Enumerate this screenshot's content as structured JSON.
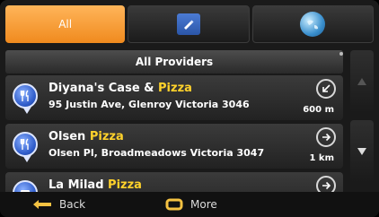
{
  "tabs": {
    "all_label": "All",
    "edit_icon": "edit-icon",
    "globe_icon": "globe-icon"
  },
  "provider_header": "All Providers",
  "results": [
    {
      "name_prefix": "Diyana's Case & ",
      "name_highlight": "Pizza",
      "name_suffix": "",
      "address": "95 Justin Ave, Glenroy Victoria 3046",
      "distance": "600 m",
      "direction_icon": "arrow-down-left-icon",
      "category_icon": "restaurant-icon"
    },
    {
      "name_prefix": "Olsen ",
      "name_highlight": "Pizza",
      "name_suffix": "",
      "address": "Olsen Pl, Broadmeadows Victoria 3047",
      "distance": "1 km",
      "direction_icon": "arrow-right-icon",
      "category_icon": "restaurant-icon"
    },
    {
      "name_prefix": "La Milad ",
      "name_highlight": "Pizza",
      "name_suffix": "",
      "address": "",
      "distance": "",
      "direction_icon": "arrow-right-icon",
      "category_icon": "car-icon"
    }
  ],
  "bottom": {
    "back_label": "Back",
    "more_label": "More"
  },
  "colors": {
    "accent_orange": "#f5a23a",
    "highlight_yellow": "#ffd22b",
    "pin_blue": "#2e5bc9"
  }
}
